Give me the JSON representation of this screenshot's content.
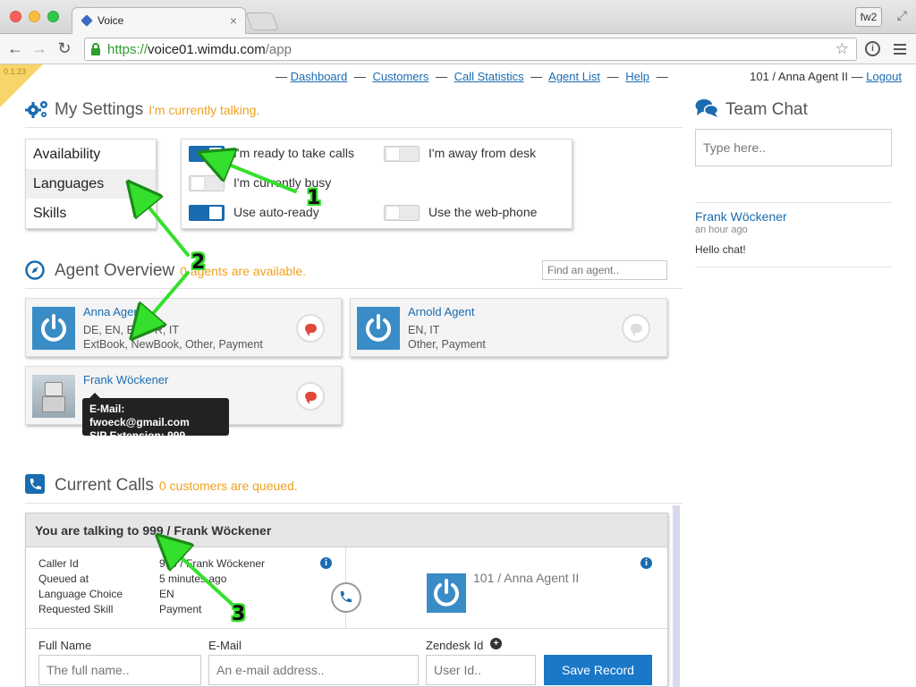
{
  "browser": {
    "tab_title": "Voice",
    "tab_close": "×",
    "profile": "fw2",
    "url_scheme": "https://",
    "url_host": "voice01.wimdu.com",
    "url_path": "/app"
  },
  "app": {
    "version": "0.1.23",
    "nav": {
      "dashboard": "Dashboard",
      "customers": "Customers",
      "call_statistics": "Call Statistics",
      "agent_list": "Agent List",
      "help": "Help",
      "dash": "—"
    },
    "user_label": "101 / Anna Agent II",
    "user_sep": "—",
    "logout": "Logout"
  },
  "settings": {
    "title": "My Settings",
    "status": "I'm currently talking.",
    "menu": [
      "Availability",
      "Languages",
      "Skills"
    ],
    "toggles": {
      "ready": {
        "label": "I'm ready to take calls",
        "on": true
      },
      "away": {
        "label": "I'm away from desk",
        "on": false
      },
      "busy": {
        "label": "I'm currently busy",
        "on": false
      },
      "auto_ready": {
        "label": "Use auto-ready",
        "on": true
      },
      "web_phone": {
        "label": "Use the web-phone",
        "on": false
      }
    }
  },
  "agents": {
    "title": "Agent Overview",
    "status": "0 agents are available.",
    "search_placeholder": "Find an agent..",
    "cards": [
      {
        "name": "Anna Agent",
        "languages": "DE, EN, ES, FR, IT",
        "skills": "ExtBook, NewBook, Other, Payment"
      },
      {
        "name": "Arnold Agent",
        "languages": "EN, IT",
        "skills": "Other, Payment"
      },
      {
        "name": "Frank Wöckener",
        "languages": "",
        "skills": ""
      }
    ],
    "tooltip_email": "E-Mail: fwoeck@gmail.com",
    "tooltip_sip": "SIP Extension: 999"
  },
  "calls": {
    "title": "Current Calls",
    "status": "0 customers are queued.",
    "header": "You are talking to 999 / Frank Wöckener",
    "details": [
      {
        "label": "Caller Id",
        "value": "999 / Frank Wöckener"
      },
      {
        "label": "Queued at",
        "value": "5 minutes ago"
      },
      {
        "label": "Language Choice",
        "value": "EN"
      },
      {
        "label": "Requested Skill",
        "value": "Payment"
      }
    ],
    "callee": "101 / Anna Agent II",
    "form": {
      "full_name_label": "Full Name",
      "full_name_placeholder": "The full name..",
      "email_label": "E-Mail",
      "email_placeholder": "An e-mail address..",
      "zendesk_label": "Zendesk Id",
      "zendesk_placeholder": "User Id..",
      "save": "Save Record"
    }
  },
  "team_chat": {
    "title": "Team Chat",
    "placeholder": "Type here..",
    "messages": [
      {
        "author": "Frank Wöckener",
        "time": "an hour ago",
        "text": "Hello chat!"
      }
    ]
  },
  "annotations": [
    "1",
    "2",
    "3"
  ],
  "colors": {
    "accent": "#1a6bb0",
    "status_orange": "#f0a11e",
    "annotation_green": "#34e02c",
    "chat_red": "#e0483a"
  }
}
